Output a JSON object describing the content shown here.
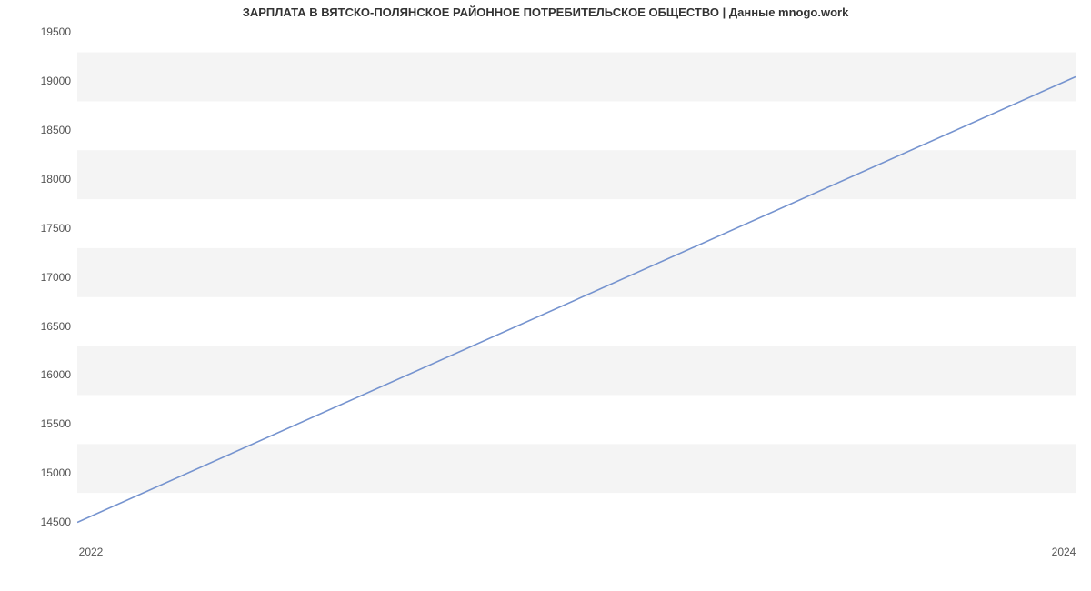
{
  "chart_data": {
    "type": "line",
    "title": "ЗАРПЛАТА В ВЯТСКО-ПОЛЯНСКОЕ РАЙОННОЕ ПОТРЕБИТЕЛЬСКОЕ ОБЩЕСТВО | Данные mnogo.work",
    "x": [
      2022,
      2024
    ],
    "values": [
      14700,
      19250
    ],
    "xlabel": "",
    "ylabel": "",
    "xticks": [
      2022,
      2024
    ],
    "yticks": [
      14500,
      15000,
      15500,
      16000,
      16500,
      17000,
      17500,
      18000,
      18500,
      19000,
      19500
    ],
    "ylim": [
      14500,
      19700
    ],
    "xlim": [
      2022,
      2024
    ],
    "grid_bands": true,
    "line_color": "#7593cf"
  }
}
